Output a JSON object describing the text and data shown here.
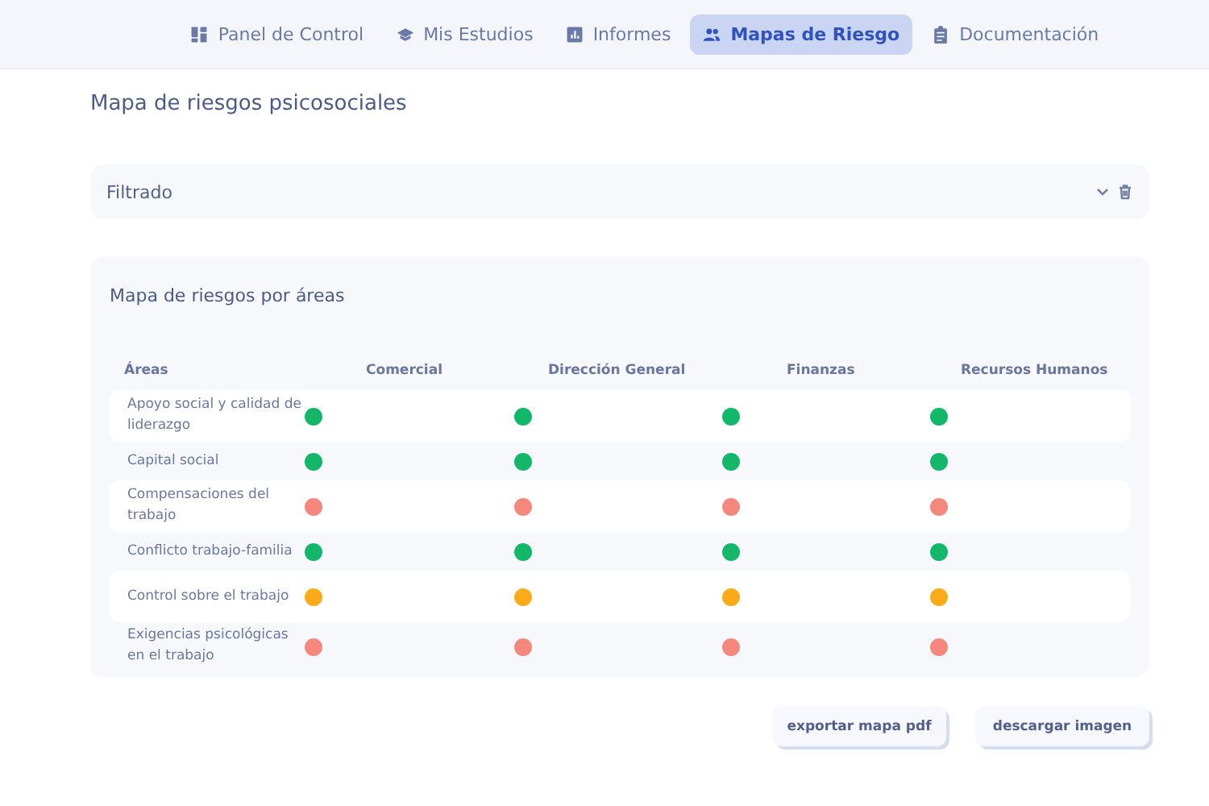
{
  "nav": {
    "tabs": [
      {
        "label": "Panel de Control",
        "selected": false
      },
      {
        "label": "Mis Estudios",
        "selected": false
      },
      {
        "label": "Informes",
        "selected": false
      },
      {
        "label": "Mapas de Riesgo",
        "selected": true
      },
      {
        "label": "Documentación",
        "selected": false
      }
    ]
  },
  "page_title": "Mapa de riesgos psicosociales",
  "filter": {
    "label": "Filtrado",
    "expanded": false
  },
  "map": {
    "title": "Mapa de riesgos por áreas",
    "columns": [
      "Áreas",
      "Comercial",
      "Dirección General",
      "Finanzas",
      "Recursos Humanos"
    ],
    "rows": [
      {
        "area": "Apoyo social y calidad de liderazgo",
        "cells": [
          {
            "color": "#12b76a"
          },
          {
            "color": "#12b76a"
          },
          {
            "color": "#12b76a"
          },
          {
            "color": "#12b76a"
          }
        ]
      },
      {
        "area": "Capital social",
        "cells": [
          {
            "color": "#12b76a"
          },
          {
            "color": "#12b76a"
          },
          {
            "color": "#12b76a"
          },
          {
            "color": "#12b76a"
          }
        ]
      },
      {
        "area": "Compensaciones del trabajo",
        "cells": [
          {
            "color": "#f5877c"
          },
          {
            "color": "#f5877c"
          },
          {
            "color": "#f5877c"
          },
          {
            "color": "#f5877c"
          }
        ]
      },
      {
        "area": "Conflicto trabajo-familia",
        "cells": [
          {
            "color": "#12b76a"
          },
          {
            "color": "#12b76a"
          },
          {
            "color": "#12b76a"
          },
          {
            "color": "#12b76a"
          }
        ]
      },
      {
        "area": "Control sobre el trabajo",
        "cells": [
          {
            "color": "#fbab18"
          },
          {
            "color": "#fbab18"
          },
          {
            "color": "#fbab18"
          },
          {
            "color": "#fbab18"
          }
        ]
      },
      {
        "area": "Exigencias psicológicas en el trabajo",
        "cells": [
          {
            "color": "#f5877c"
          },
          {
            "color": "#f5877c"
          },
          {
            "color": "#f5877c"
          },
          {
            "color": "#f5877c"
          }
        ]
      }
    ]
  },
  "buttons": [
    "exportar mapa pdf",
    "descargar imagen"
  ]
}
